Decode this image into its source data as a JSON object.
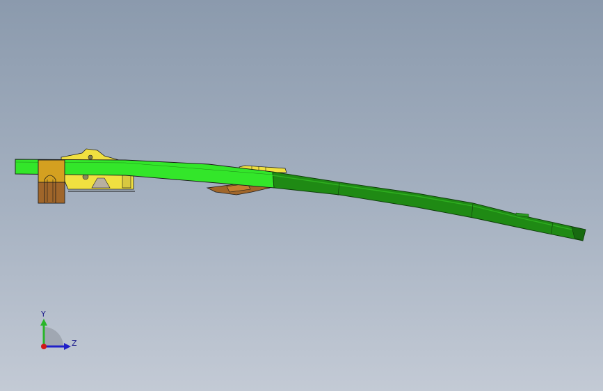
{
  "viewport": {
    "background_top": "#8b9aad",
    "background_bottom": "#c3cad5"
  },
  "model": {
    "colors": {
      "rail_bright": "#33e62a",
      "rail_dark": "#1f8a14",
      "bracket_yellow": "#f0e040",
      "clip_orange": "#d4a020",
      "clip_brown": "#a0662a",
      "edge": "#1a1a1a"
    }
  },
  "triad": {
    "y_label": "Y",
    "z_label": "Z",
    "colors": {
      "y_axis": "#2ab52a",
      "z_axis": "#2020c8",
      "x_origin": "#d01818",
      "quadrant": "#9aa0aa"
    },
    "icon": "coordinate-triad-icon"
  }
}
